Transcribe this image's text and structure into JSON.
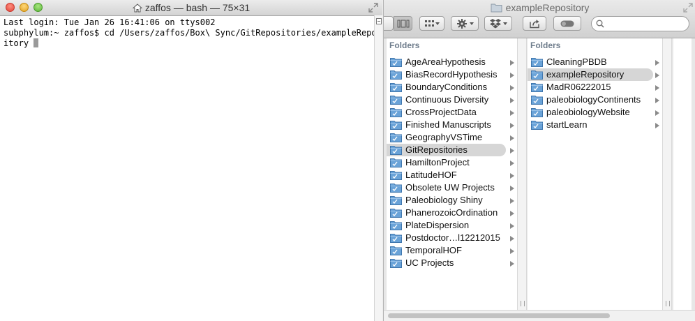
{
  "terminal": {
    "title": "zaffos — bash — 75×31",
    "lines": [
      "Last login: Tue Jan 26 16:41:06 on ttys002",
      "subphylum:~ zaffos$ cd /Users/zaffos/Box\\ Sync/GitRepositories/exampleRepos",
      "itory "
    ]
  },
  "finder": {
    "title": "exampleRepository",
    "search": {
      "placeholder": "",
      "value": ""
    },
    "column1": {
      "header": "Folders",
      "selected_index": 7,
      "items": [
        "AgeAreaHypothesis",
        "BiasRecordHypothesis",
        "BoundaryConditions",
        "Continuous Diversity",
        "CrossProjectData",
        "Finished Manuscripts",
        "GeographyVSTime",
        "GitRepositories",
        "HamiltonProject",
        "LatitudeHOF",
        "Obsolete UW Projects",
        "Paleobiology Shiny",
        "PhanerozoicOrdination",
        "PlateDispersion",
        "Postdoctor…l12212015",
        "TemporalHOF",
        "UC Projects"
      ]
    },
    "column2": {
      "header": "Folders",
      "selected_index": 1,
      "items": [
        "CleaningPBDB",
        "exampleRepository",
        "MadR06222015",
        "paleobiologyContinents",
        "paleobiologyWebsite",
        "startLearn"
      ]
    }
  },
  "colors": {
    "folder_blue": "#6aa3d8",
    "selection_gray": "#d6d6d6",
    "header_text": "#6f7d8c"
  }
}
